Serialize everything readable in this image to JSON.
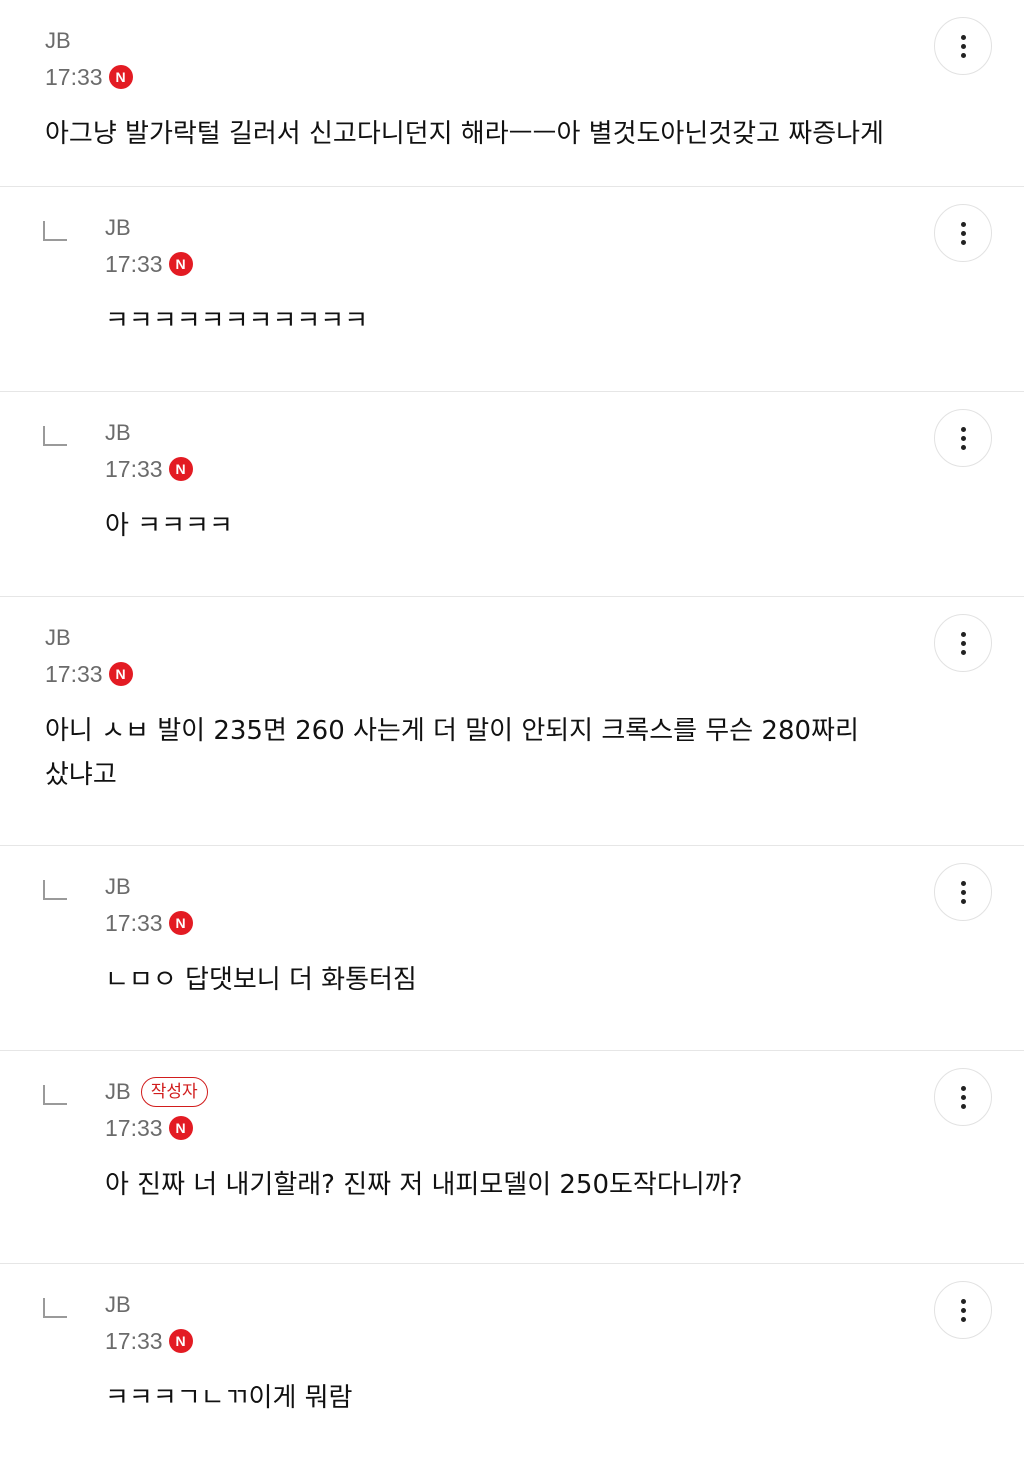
{
  "comments": [
    {
      "author": "JB",
      "time": "17:33",
      "new_badge": "N",
      "text": "아그냥 발가락털 길러서 신고다니던지 해라ㅡㅡ아 별것도아닌것갖고 짜증나게"
    },
    {
      "author": "JB",
      "time": "17:33",
      "new_badge": "N",
      "text": "ㅋㅋㅋㅋㅋㅋㅋㅋㅋㅋㅋ"
    },
    {
      "author": "JB",
      "time": "17:33",
      "new_badge": "N",
      "text": "아 ㅋㅋㅋㅋ"
    },
    {
      "author": "JB",
      "time": "17:33",
      "new_badge": "N",
      "text": "아니 ㅅㅂ 발이 235면 260 사는게 더 말이 안되지 크록스를 무슨 280짜리 샀냐고"
    },
    {
      "author": "JB",
      "time": "17:33",
      "new_badge": "N",
      "text": "ㄴㅁㅇ 답댓보니 더 화통터짐"
    },
    {
      "author": "JB",
      "author_badge": "작성자",
      "time": "17:33",
      "new_badge": "N",
      "text": "아 진짜 너 내기할래? 진짜 저 내피모델이 250도작다니까?"
    },
    {
      "author": "JB",
      "time": "17:33",
      "new_badge": "N",
      "text": "ㅋㅋㅋㄱㄴㄲ이게 뭐람"
    }
  ],
  "icons": {
    "more": "more-vertical-icon",
    "reply": "reply-arrow-icon",
    "new": "new-badge-icon"
  },
  "colors": {
    "accent": "#e31b23",
    "meta_text": "#6b6b6b",
    "divider": "#e6e6e6"
  }
}
